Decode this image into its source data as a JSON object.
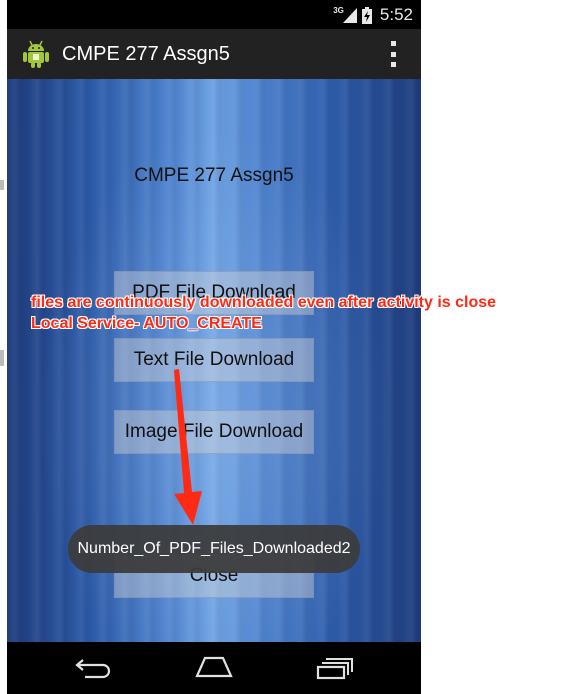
{
  "status_bar": {
    "network": "3G",
    "time": "5:52"
  },
  "action_bar": {
    "title": "CMPE 277 Assgn5",
    "overflow_icon": "overflow-menu-icon"
  },
  "main": {
    "heading": "CMPE 277 Assgn5",
    "buttons": [
      {
        "label": "PDF File Download"
      },
      {
        "label": "Text File Download"
      },
      {
        "label": "Image File Download"
      },
      {
        "label": "Close"
      }
    ]
  },
  "toast": {
    "text": "Number_Of_PDF_Files_Downloaded2"
  },
  "annotation": {
    "line1": "files are continuously downloaded even after activity is close",
    "line2": "Local Service- AUTO_CREATE",
    "color": "#ff2a14"
  },
  "nav_bar": {
    "icons": [
      "back-icon",
      "home-icon",
      "recents-icon"
    ]
  },
  "colors": {
    "action_bar": "#222222",
    "background_blue": "#2c5aa8",
    "toast_bg": "#3c3c3c"
  }
}
